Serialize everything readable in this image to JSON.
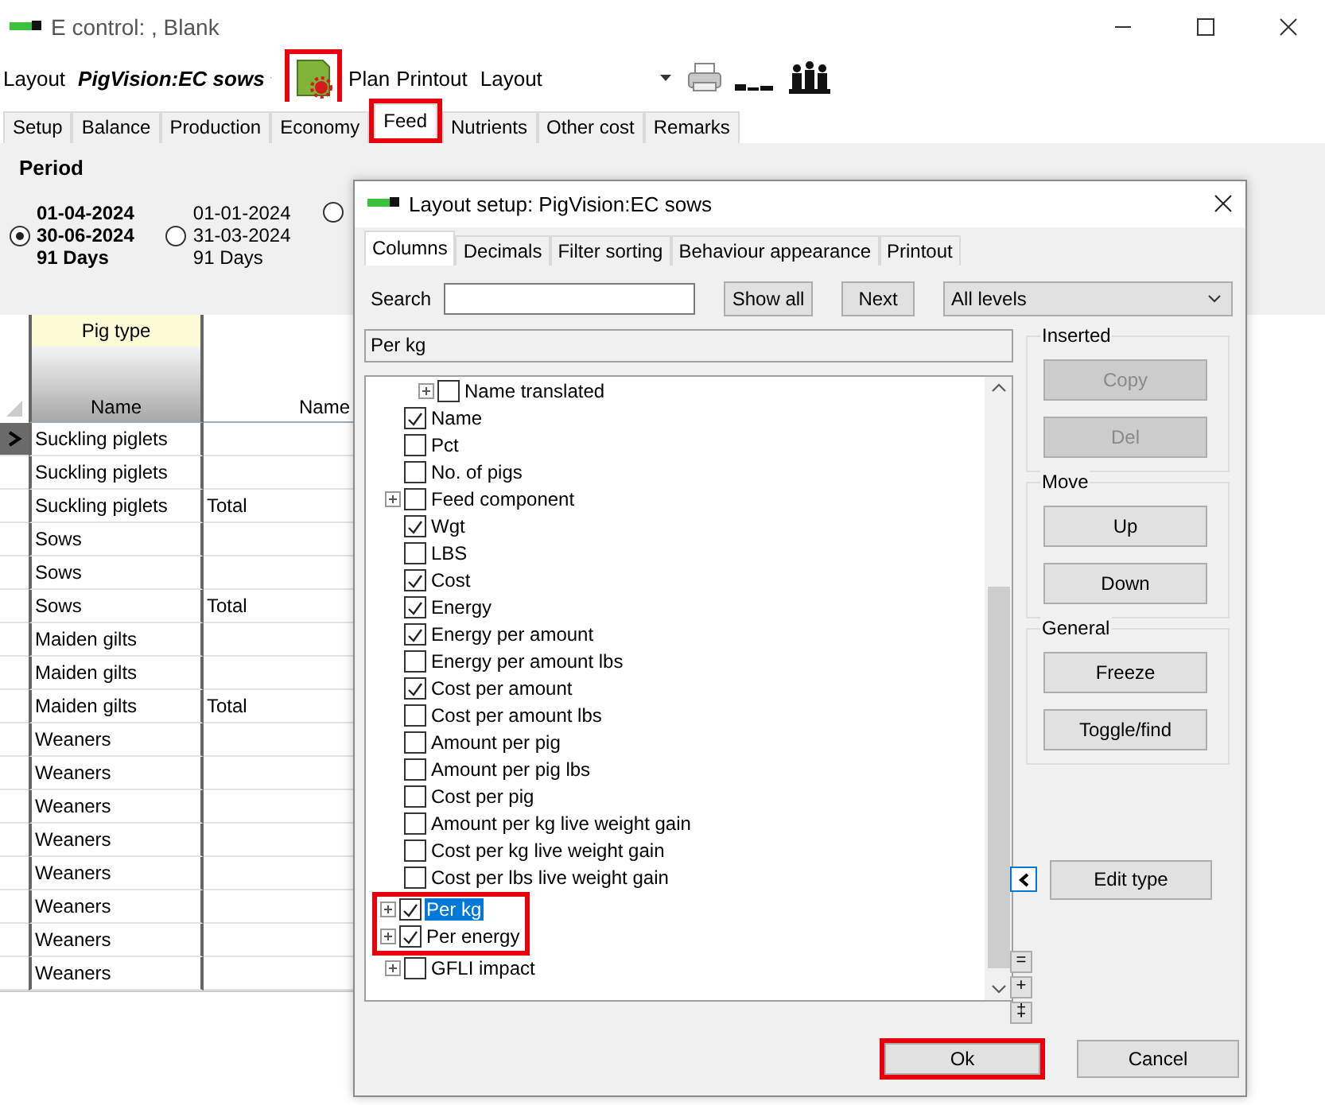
{
  "window": {
    "title": "E control: , Blank"
  },
  "toolbar": {
    "layout_label": "Layout",
    "layout_value": "PigVision:EC sows",
    "settings_highlighted": true,
    "plan_label": "Plan",
    "printout_label": "Printout",
    "printout_value": "Layout"
  },
  "tabs": [
    {
      "label": "Setup",
      "selected": false
    },
    {
      "label": "Balance",
      "selected": false
    },
    {
      "label": "Production",
      "selected": false
    },
    {
      "label": "Economy",
      "selected": false
    },
    {
      "label": "Feed",
      "selected": true,
      "highlighted": true
    },
    {
      "label": "Nutrients",
      "selected": false
    },
    {
      "label": "Other cost",
      "selected": false
    },
    {
      "label": "Remarks",
      "selected": false
    }
  ],
  "period": {
    "title": "Period",
    "options": [
      {
        "lines": [
          "01-04-2024",
          "30-06-2024",
          "91 Days"
        ],
        "selected": true
      },
      {
        "lines": [
          "01-01-2024",
          "31-03-2024",
          "91 Days"
        ],
        "selected": false
      },
      {
        "selected": false
      }
    ]
  },
  "grid": {
    "group_header": "Pig type",
    "columns": [
      "Name",
      "Name"
    ],
    "rows": [
      {
        "pig_type": "Suckling piglets",
        "current": true
      },
      {
        "pig_type": "Suckling piglets",
        "current": false
      },
      {
        "pig_type": "Suckling piglets",
        "name": "Total",
        "current": false
      },
      {
        "pig_type": "Sows",
        "current": false
      },
      {
        "pig_type": "Sows",
        "current": false
      },
      {
        "pig_type": "Sows",
        "name": "Total",
        "current": false
      },
      {
        "pig_type": "Maiden gilts",
        "current": false
      },
      {
        "pig_type": "Maiden gilts",
        "current": false
      },
      {
        "pig_type": "Maiden gilts",
        "name": "Total",
        "current": false
      },
      {
        "pig_type": "Weaners",
        "current": false
      },
      {
        "pig_type": "Weaners",
        "current": false
      },
      {
        "pig_type": "Weaners",
        "current": false
      },
      {
        "pig_type": "Weaners",
        "current": false
      },
      {
        "pig_type": "Weaners",
        "current": false
      },
      {
        "pig_type": "Weaners",
        "current": false
      },
      {
        "pig_type": "Weaners",
        "current": false
      },
      {
        "pig_type": "Weaners",
        "current": false
      }
    ]
  },
  "dialog": {
    "title": "Layout setup: PigVision:EC sows",
    "tabs": [
      {
        "label": "Columns",
        "selected": true
      },
      {
        "label": "Decimals",
        "selected": false
      },
      {
        "label": "Filter sorting",
        "selected": false
      },
      {
        "label": "Behaviour  appearance",
        "selected": false
      },
      {
        "label": "Printout",
        "selected": false
      }
    ],
    "search_label": "Search",
    "show_all": "Show all",
    "next": "Next",
    "level_filter": "All levels",
    "current_column": "Per kg",
    "tree": [
      {
        "children": [
          {
            "label": "Name translated",
            "checked": false,
            "expandable": true,
            "selected": false
          }
        ]
      },
      {
        "label": "Name",
        "checked": true,
        "expandable": false,
        "selected": false
      },
      {
        "label": "Pct",
        "checked": false,
        "expandable": false,
        "selected": false
      },
      {
        "label": "No. of pigs",
        "checked": false,
        "expandable": false,
        "selected": false
      },
      {
        "label": "Feed component",
        "checked": false,
        "expandable": true,
        "selected": false
      },
      {
        "label": "Wgt",
        "checked": true,
        "expandable": false,
        "selected": false
      },
      {
        "label": "LBS",
        "checked": false,
        "expandable": false,
        "selected": false
      },
      {
        "label": "Cost",
        "checked": true,
        "expandable": false,
        "selected": false
      },
      {
        "label": "Energy",
        "checked": true,
        "expandable": false,
        "selected": false
      },
      {
        "label": "Energy per amount",
        "checked": true,
        "expandable": false,
        "selected": false
      },
      {
        "label": "Energy per amount lbs",
        "checked": false,
        "expandable": false,
        "selected": false
      },
      {
        "label": "Cost per amount",
        "checked": true,
        "expandable": false,
        "selected": false
      },
      {
        "label": "Cost per amount lbs",
        "checked": false,
        "expandable": false,
        "selected": false
      },
      {
        "label": "Amount per pig",
        "checked": false,
        "expandable": false,
        "selected": false
      },
      {
        "label": "Amount per pig lbs",
        "checked": false,
        "expandable": false,
        "selected": false
      },
      {
        "label": "Cost per pig",
        "checked": false,
        "expandable": false,
        "selected": false
      },
      {
        "label": "Amount per kg live weight gain",
        "checked": false,
        "expandable": false,
        "selected": false
      },
      {
        "label": "Cost per kg live weight gain",
        "checked": false,
        "expandable": false,
        "selected": false
      },
      {
        "label": "Cost per lbs live weight gain",
        "checked": false,
        "expandable": false,
        "selected": false
      },
      {
        "label": "Per kg",
        "checked": true,
        "expandable": true,
        "selected": true,
        "highlighted": true
      },
      {
        "label": "Per energy",
        "checked": true,
        "expandable": true,
        "selected": false,
        "highlighted": true
      },
      {
        "label": "GFLI impact",
        "checked": false,
        "expandable": true,
        "selected": false
      }
    ],
    "groups": [
      {
        "title": "Inserted",
        "buttons": [
          {
            "label": "Copy",
            "disabled": true
          },
          {
            "label": "Del",
            "disabled": true
          }
        ]
      },
      {
        "title": "Move",
        "buttons": [
          {
            "label": "Up",
            "disabled": false
          },
          {
            "label": "Down",
            "disabled": false
          }
        ]
      },
      {
        "title": "General",
        "buttons": [
          {
            "label": "Freeze",
            "disabled": false
          },
          {
            "label": "Toggle/find",
            "disabled": false
          }
        ]
      }
    ],
    "edit_type": "Edit type",
    "size_buttons": [
      "=",
      "+",
      "‡"
    ],
    "ok": {
      "label": "Ok",
      "highlighted": true
    },
    "cancel": "Cancel"
  }
}
